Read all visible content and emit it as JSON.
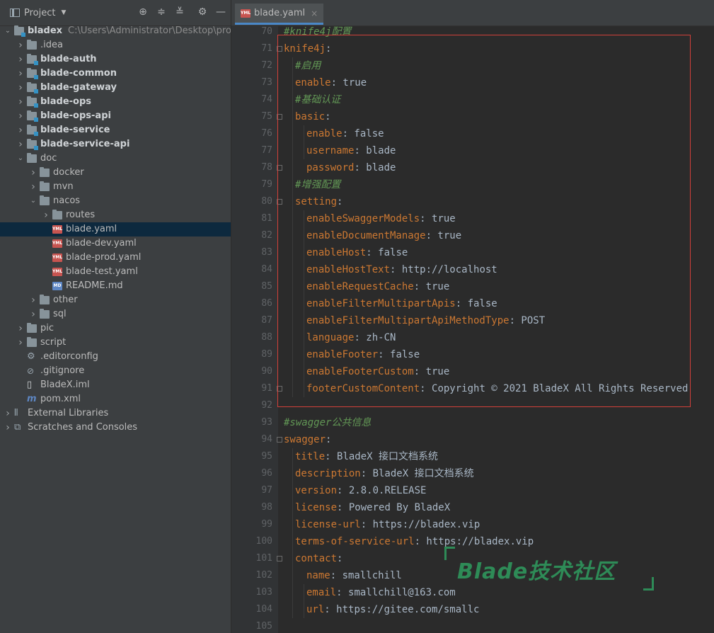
{
  "project_panel": {
    "title": "Project",
    "root": {
      "name": "bladex",
      "path": "C:\\Users\\Administrator\\Desktop\\project"
    },
    "tree": [
      {
        "label": "bladex",
        "extra": "C:\\Users\\Administrator\\Desktop\\project",
        "depth": 0,
        "icon": "module-folder-icon",
        "arrow": "down",
        "bold": true
      },
      {
        "label": ".idea",
        "depth": 1,
        "icon": "folder-icon",
        "arrow": "right"
      },
      {
        "label": "blade-auth",
        "depth": 1,
        "icon": "module-folder-icon",
        "arrow": "right",
        "bold": true
      },
      {
        "label": "blade-common",
        "depth": 1,
        "icon": "module-folder-icon",
        "arrow": "right",
        "bold": true
      },
      {
        "label": "blade-gateway",
        "depth": 1,
        "icon": "module-folder-icon",
        "arrow": "right",
        "bold": true
      },
      {
        "label": "blade-ops",
        "depth": 1,
        "icon": "module-folder-icon",
        "arrow": "right",
        "bold": true
      },
      {
        "label": "blade-ops-api",
        "depth": 1,
        "icon": "module-folder-icon",
        "arrow": "right",
        "bold": true
      },
      {
        "label": "blade-service",
        "depth": 1,
        "icon": "module-folder-icon",
        "arrow": "right",
        "bold": true
      },
      {
        "label": "blade-service-api",
        "depth": 1,
        "icon": "module-folder-icon",
        "arrow": "right",
        "bold": true
      },
      {
        "label": "doc",
        "depth": 1,
        "icon": "folder-icon",
        "arrow": "down"
      },
      {
        "label": "docker",
        "depth": 2,
        "icon": "folder-icon",
        "arrow": "right"
      },
      {
        "label": "mvn",
        "depth": 2,
        "icon": "folder-icon",
        "arrow": "right"
      },
      {
        "label": "nacos",
        "depth": 2,
        "icon": "folder-icon",
        "arrow": "down"
      },
      {
        "label": "routes",
        "depth": 3,
        "icon": "folder-icon",
        "arrow": "right"
      },
      {
        "label": "blade.yaml",
        "depth": 3,
        "icon": "yaml-file-icon",
        "selected": true
      },
      {
        "label": "blade-dev.yaml",
        "depth": 3,
        "icon": "yaml-file-icon"
      },
      {
        "label": "blade-prod.yaml",
        "depth": 3,
        "icon": "yaml-file-icon"
      },
      {
        "label": "blade-test.yaml",
        "depth": 3,
        "icon": "yaml-file-icon"
      },
      {
        "label": "README.md",
        "depth": 3,
        "icon": "markdown-file-icon"
      },
      {
        "label": "other",
        "depth": 2,
        "icon": "folder-icon",
        "arrow": "right"
      },
      {
        "label": "sql",
        "depth": 2,
        "icon": "folder-icon",
        "arrow": "right"
      },
      {
        "label": "pic",
        "depth": 1,
        "icon": "folder-icon",
        "arrow": "right"
      },
      {
        "label": "script",
        "depth": 1,
        "icon": "folder-icon",
        "arrow": "right"
      },
      {
        "label": ".editorconfig",
        "depth": 1,
        "icon": "gear-file-icon"
      },
      {
        "label": ".gitignore",
        "depth": 1,
        "icon": "gitignore-file-icon"
      },
      {
        "label": "BladeX.iml",
        "depth": 1,
        "icon": "iml-file-icon"
      },
      {
        "label": "pom.xml",
        "depth": 1,
        "icon": "maven-file-icon"
      },
      {
        "label": "External Libraries",
        "depth": 0,
        "icon": "library-icon",
        "arrow": "right"
      },
      {
        "label": "Scratches and Consoles",
        "depth": 0,
        "icon": "scratches-icon",
        "arrow": "right"
      }
    ]
  },
  "editor": {
    "tab_label": "blade.yaml",
    "tab_close": "×",
    "lines": [
      {
        "n": "70",
        "indent": 0,
        "parts": [
          {
            "t": "#knife4j配置",
            "c": "cmt"
          }
        ]
      },
      {
        "n": "71",
        "indent": 0,
        "parts": [
          {
            "t": "knife4j",
            "c": "key"
          },
          {
            "t": ":",
            "c": "val"
          }
        ],
        "fold": true
      },
      {
        "n": "72",
        "indent": 1,
        "parts": [
          {
            "t": "#启用",
            "c": "cmt"
          }
        ]
      },
      {
        "n": "73",
        "indent": 1,
        "parts": [
          {
            "t": "enable",
            "c": "key"
          },
          {
            "t": ": true",
            "c": "val"
          }
        ]
      },
      {
        "n": "74",
        "indent": 1,
        "parts": [
          {
            "t": "#基础认证",
            "c": "cmt"
          }
        ]
      },
      {
        "n": "75",
        "indent": 1,
        "parts": [
          {
            "t": "basic",
            "c": "key"
          },
          {
            "t": ":",
            "c": "val"
          }
        ],
        "fold": true
      },
      {
        "n": "76",
        "indent": 2,
        "parts": [
          {
            "t": "enable",
            "c": "key"
          },
          {
            "t": ": false",
            "c": "val"
          }
        ]
      },
      {
        "n": "77",
        "indent": 2,
        "parts": [
          {
            "t": "username",
            "c": "key"
          },
          {
            "t": ": blade",
            "c": "val"
          }
        ]
      },
      {
        "n": "78",
        "indent": 2,
        "parts": [
          {
            "t": "password",
            "c": "key"
          },
          {
            "t": ": blade",
            "c": "val"
          }
        ],
        "fold": true
      },
      {
        "n": "79",
        "indent": 1,
        "parts": [
          {
            "t": "#增强配置",
            "c": "cmt"
          }
        ]
      },
      {
        "n": "80",
        "indent": 1,
        "parts": [
          {
            "t": "setting",
            "c": "key"
          },
          {
            "t": ":",
            "c": "val"
          }
        ],
        "fold": true
      },
      {
        "n": "81",
        "indent": 2,
        "parts": [
          {
            "t": "enableSwaggerModels",
            "c": "key"
          },
          {
            "t": ": true",
            "c": "val"
          }
        ]
      },
      {
        "n": "82",
        "indent": 2,
        "parts": [
          {
            "t": "enableDocumentManage",
            "c": "key"
          },
          {
            "t": ": true",
            "c": "val"
          }
        ]
      },
      {
        "n": "83",
        "indent": 2,
        "parts": [
          {
            "t": "enableHost",
            "c": "key"
          },
          {
            "t": ": false",
            "c": "val"
          }
        ]
      },
      {
        "n": "84",
        "indent": 2,
        "parts": [
          {
            "t": "enableHostText",
            "c": "key"
          },
          {
            "t": ": http://localhost",
            "c": "val"
          }
        ]
      },
      {
        "n": "85",
        "indent": 2,
        "parts": [
          {
            "t": "enableRequestCache",
            "c": "key"
          },
          {
            "t": ": true",
            "c": "val"
          }
        ]
      },
      {
        "n": "86",
        "indent": 2,
        "parts": [
          {
            "t": "enableFilterMultipartApis",
            "c": "key"
          },
          {
            "t": ": false",
            "c": "val"
          }
        ]
      },
      {
        "n": "87",
        "indent": 2,
        "parts": [
          {
            "t": "enableFilterMultipartApiMethodType",
            "c": "key"
          },
          {
            "t": ": POST",
            "c": "val"
          }
        ]
      },
      {
        "n": "88",
        "indent": 2,
        "parts": [
          {
            "t": "language",
            "c": "key"
          },
          {
            "t": ": zh-CN",
            "c": "val"
          }
        ]
      },
      {
        "n": "89",
        "indent": 2,
        "parts": [
          {
            "t": "enableFooter",
            "c": "key"
          },
          {
            "t": ": false",
            "c": "val"
          }
        ]
      },
      {
        "n": "90",
        "indent": 2,
        "parts": [
          {
            "t": "enableFooterCustom",
            "c": "key"
          },
          {
            "t": ": true",
            "c": "val"
          }
        ]
      },
      {
        "n": "91",
        "indent": 2,
        "parts": [
          {
            "t": "footerCustomContent",
            "c": "key"
          },
          {
            "t": ": Copyright © 2021 BladeX All Rights Reserved",
            "c": "val"
          }
        ],
        "fold": true
      },
      {
        "n": "92",
        "indent": 0,
        "parts": []
      },
      {
        "n": "93",
        "indent": 0,
        "parts": [
          {
            "t": "#swagger公共信息",
            "c": "cmt"
          }
        ]
      },
      {
        "n": "94",
        "indent": 0,
        "parts": [
          {
            "t": "swagger",
            "c": "key"
          },
          {
            "t": ":",
            "c": "val"
          }
        ],
        "fold": true
      },
      {
        "n": "95",
        "indent": 1,
        "parts": [
          {
            "t": "title",
            "c": "key"
          },
          {
            "t": ": BladeX 接口文档系统",
            "c": "val"
          }
        ]
      },
      {
        "n": "96",
        "indent": 1,
        "parts": [
          {
            "t": "description",
            "c": "key"
          },
          {
            "t": ": BladeX 接口文档系统",
            "c": "val"
          }
        ]
      },
      {
        "n": "97",
        "indent": 1,
        "parts": [
          {
            "t": "version",
            "c": "key"
          },
          {
            "t": ": 2.8.0.RELEASE",
            "c": "val"
          }
        ]
      },
      {
        "n": "98",
        "indent": 1,
        "parts": [
          {
            "t": "license",
            "c": "key"
          },
          {
            "t": ": Powered By BladeX",
            "c": "val"
          }
        ]
      },
      {
        "n": "99",
        "indent": 1,
        "parts": [
          {
            "t": "license-url",
            "c": "key"
          },
          {
            "t": ": https://bladex.vip",
            "c": "val"
          }
        ]
      },
      {
        "n": "100",
        "indent": 1,
        "parts": [
          {
            "t": "terms-of-service-url",
            "c": "key"
          },
          {
            "t": ": https://bladex.vip",
            "c": "val"
          }
        ]
      },
      {
        "n": "101",
        "indent": 1,
        "parts": [
          {
            "t": "contact",
            "c": "key"
          },
          {
            "t": ":",
            "c": "val"
          }
        ],
        "fold": true
      },
      {
        "n": "102",
        "indent": 2,
        "parts": [
          {
            "t": "name",
            "c": "key"
          },
          {
            "t": ": smallchill",
            "c": "val"
          }
        ]
      },
      {
        "n": "103",
        "indent": 2,
        "parts": [
          {
            "t": "email",
            "c": "key"
          },
          {
            "t": ": smallchill@163.com",
            "c": "val"
          }
        ]
      },
      {
        "n": "104",
        "indent": 2,
        "parts": [
          {
            "t": "url",
            "c": "key"
          },
          {
            "t": ": https://gitee.com/smallc",
            "c": "val"
          }
        ]
      },
      {
        "n": "105",
        "indent": 0,
        "parts": []
      }
    ]
  },
  "watermark": {
    "text": "Blade技术社区",
    "color": "#2e8b57"
  },
  "colors": {
    "key": "#cc7832",
    "comment": "#629755",
    "value": "#a9b7c6",
    "highlight_border": "#d2403a",
    "selection": "#0d293e"
  }
}
